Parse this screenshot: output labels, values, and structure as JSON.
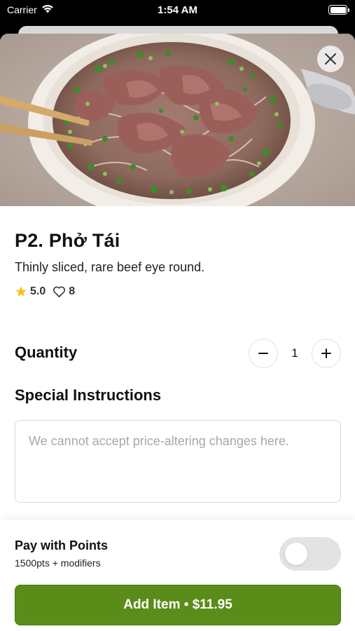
{
  "status_bar": {
    "carrier": "Carrier",
    "time": "1:54 AM"
  },
  "item": {
    "title": "P2. Phở Tái",
    "description": "Thinly sliced, rare beef eye round.",
    "rating": "5.0",
    "likes": "8",
    "image_alt": "Bowl of pho with rare beef and green onions"
  },
  "quantity": {
    "label": "Quantity",
    "value": "1"
  },
  "special_instructions": {
    "label": "Special Instructions",
    "placeholder": "We cannot accept price-altering changes here.",
    "value": ""
  },
  "points": {
    "title": "Pay with Points",
    "subtitle": "1500pts + modifiers",
    "enabled": false
  },
  "add_button": {
    "label": "Add Item • $11.95"
  },
  "colors": {
    "primary": "#5a8c1a",
    "star": "#f5c518",
    "toggle_off": "#e3e3e3"
  },
  "icons": [
    "wifi-icon",
    "battery-icon",
    "close-icon",
    "star-icon",
    "heart-icon",
    "minus-icon",
    "plus-icon"
  ]
}
